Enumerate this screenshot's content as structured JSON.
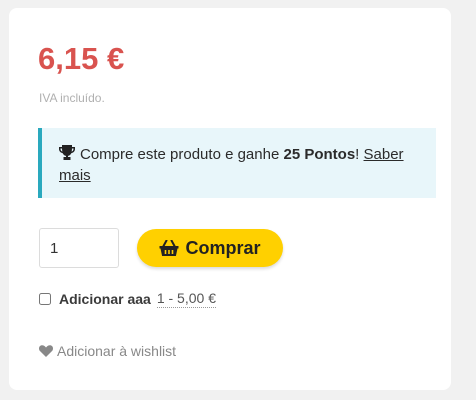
{
  "product": {
    "price": "6,15 €",
    "tax_note": "IVA incluído."
  },
  "points_notice": {
    "icon": "trophy-icon",
    "text_before": "Compre este produto e ganhe",
    "points": "25 Pontos",
    "text_after": "!",
    "link_label": "Saber mais"
  },
  "purchase": {
    "quantity": "1",
    "buy_label": "Comprar",
    "buy_icon": "basket-icon",
    "button_color": "#ffd000"
  },
  "addon": {
    "label": "Adicionar aaa",
    "price": "1 - 5,00 €",
    "checked": false
  },
  "wishlist": {
    "icon": "heart-icon",
    "label": "Adicionar à wishlist"
  },
  "colors": {
    "price": "#d9534f",
    "notice_bg": "#e8f6fa",
    "notice_border": "#2aa9be"
  }
}
